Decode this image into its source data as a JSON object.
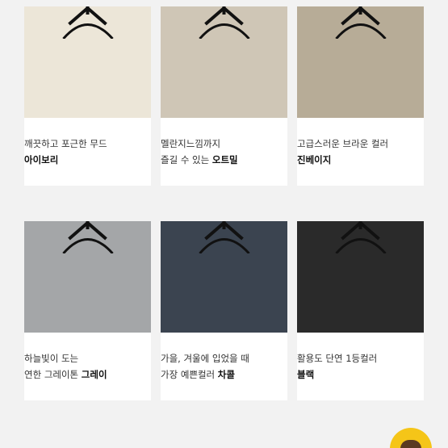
{
  "products": [
    {
      "line1": "깨끗하고 포근한 무드",
      "line2_pre": "",
      "line2_bold": "아이보리",
      "color": "#ece6d8"
    },
    {
      "line1": "멜란지느낌까지",
      "line2_pre": "즐길 수 있는 ",
      "line2_bold": "오트밀",
      "color": "#cfc6b6"
    },
    {
      "line1": "고급스러운 브라운 컬러",
      "line2_pre": "",
      "line2_bold": "진베이지",
      "color": "#b7ac97"
    },
    {
      "line1": "하늘빛이 도는",
      "line2_pre": "연한 그레이톤 ",
      "line2_bold": "그레이",
      "color": "#a4a6a8"
    },
    {
      "line1": "가을, 겨울에 입었을 때",
      "line2_pre": "가장 예쁜컬러 ",
      "line2_bold": "차콜",
      "color": "#3b4450"
    },
    {
      "line1": "활용도 단연 1등컬러",
      "line2_pre": "",
      "line2_bold": "블랙",
      "color": "#2a2a2a"
    }
  ],
  "badge": {
    "icon": "chat-bot-icon",
    "color": "#f5c518"
  }
}
